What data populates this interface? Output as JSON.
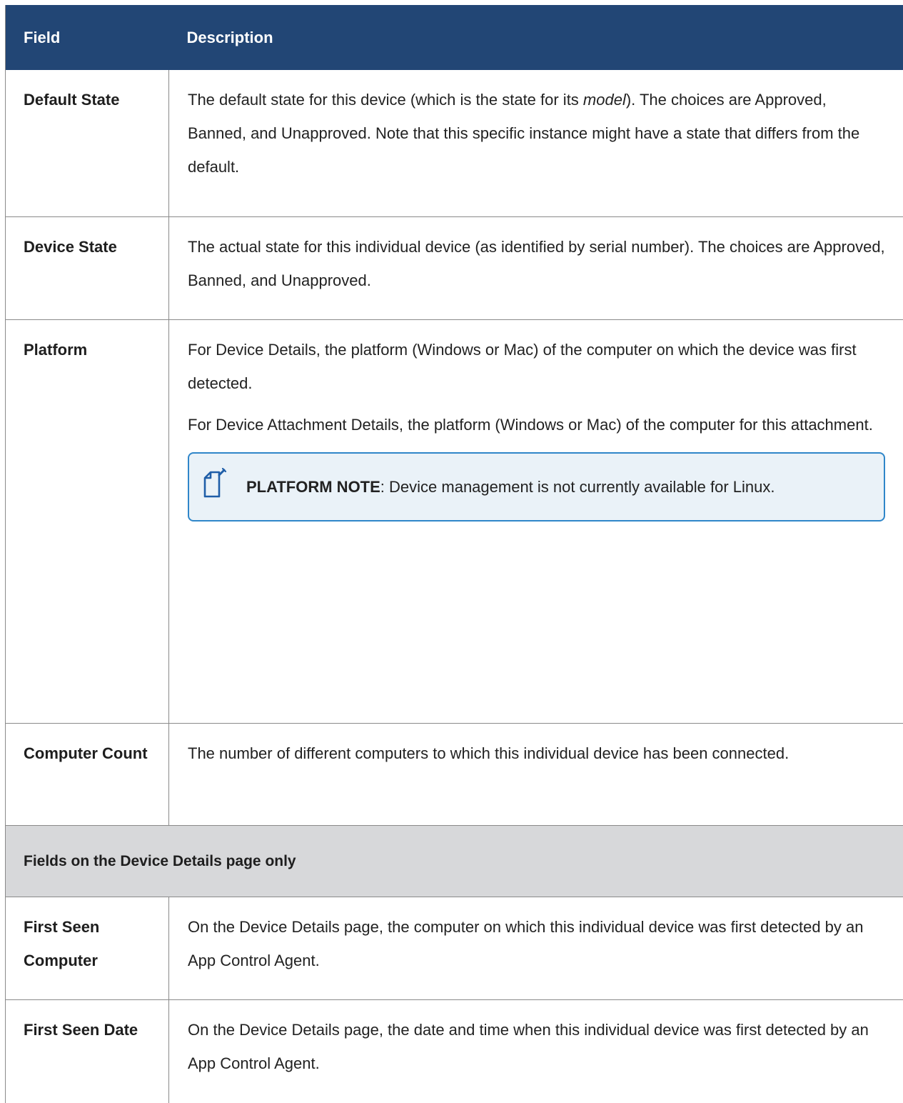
{
  "header": {
    "field": "Field",
    "description": "Description"
  },
  "rows": {
    "default_state": {
      "field": "Default State",
      "desc_part1": "The default state for this device (which is the state for its ",
      "desc_em": "model",
      "desc_part2": "). The choices are Approved, Banned, and Unapproved. Note that this specific instance might have a state that differs from the default."
    },
    "device_state": {
      "field": "Device State",
      "desc": "The actual state for this individual device (as identified by serial number). The choices are Approved, Banned, and Unapproved."
    },
    "platform": {
      "field": "Platform",
      "desc1": "For Device Details, the platform (Windows or Mac) of the computer on which the device was first detected.",
      "desc2": "For Device Attachment Details, the platform (Windows or Mac) of the computer for this attachment.",
      "note_label": "PLATFORM NOTE",
      "note_text": ": Device management is not currently available for Linux.",
      "note_icon": "note-edit-icon"
    },
    "computer_count": {
      "field": "Computer Count",
      "desc": "The number of different computers to which this individual device has been connected."
    },
    "section": {
      "title": "Fields on the Device Details page only"
    },
    "first_seen_computer": {
      "field": "First Seen Computer",
      "desc": "On the Device Details page, the computer on which this individual device was first detected by an App Control Agent."
    },
    "first_seen_date": {
      "field": "First Seen Date",
      "desc": "On the Device Details page, the date and time when this individual device was first detected by an App Control Agent."
    }
  },
  "colors": {
    "header_bg": "#224675",
    "section_bg": "#d7d8da",
    "note_border": "#2f86c9",
    "note_bg": "#eaf2f8"
  }
}
